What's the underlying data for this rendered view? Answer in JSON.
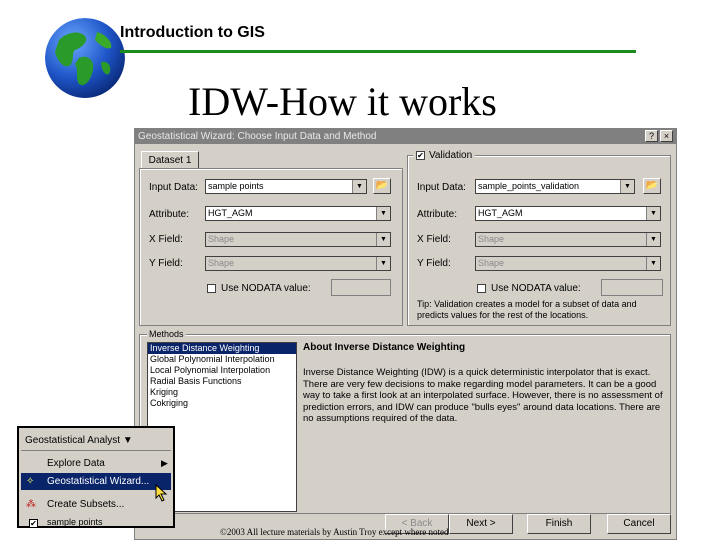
{
  "slide": {
    "header": "Introduction to GIS",
    "title": "IDW-How it works",
    "footer": "©2003 All lecture materials by Austin Troy except where noted"
  },
  "dialog": {
    "title": "Geostatistical Wizard: Choose Input Data and Method",
    "help_button": "?",
    "close_button": "×",
    "dataset_tab": "Dataset 1",
    "validation_label": "Validation",
    "validation_checked": true,
    "left": {
      "input_label": "Input Data:",
      "input_value": "sample points",
      "attribute_label": "Attribute:",
      "attribute_value": "HGT_AGM",
      "xfield_label": "X Field:",
      "xfield_value": "Shape",
      "yfield_label": "Y Field:",
      "yfield_value": "Shape",
      "nodata_label": "Use NODATA value:"
    },
    "right": {
      "input_label": "Input Data:",
      "input_value": "sample_points_validation",
      "attribute_label": "Attribute:",
      "attribute_value": "HGT_AGM",
      "xfield_label": "X Field:",
      "xfield_value": "Shape",
      "yfield_label": "Y Field:",
      "yfield_value": "Shape",
      "nodata_label": "Use NODATA value:",
      "tip": "Tip: Validation creates a model for a subset of data and predicts values for the rest of the locations."
    },
    "methods_label": "Methods",
    "methods": [
      "Inverse Distance Weighting",
      "Global Polynomial Interpolation",
      "Local Polynomial Interpolation",
      "Radial Basis Functions",
      "Kriging",
      "Cokriging"
    ],
    "about_title": "About Inverse Distance Weighting",
    "about_text": "Inverse Distance Weighting (IDW) is a quick deterministic interpolator that is exact. There are very few decisions to make regarding model parameters. It can be a good way to take a first look at an interpolated surface. However, there is no assessment of prediction errors, and IDW can produce \"bulls eyes\" around data locations. There are no assumptions required of the data.",
    "buttons": {
      "back": "< Back",
      "next": "Next >",
      "finish": "Finish",
      "cancel": "Cancel"
    }
  },
  "menu": {
    "title": "Geostatistical Analyst ▼",
    "items": [
      "Explore Data",
      "Geostatistical Wizard...",
      "Create Subsets..."
    ],
    "bottom_item": "sample points"
  }
}
